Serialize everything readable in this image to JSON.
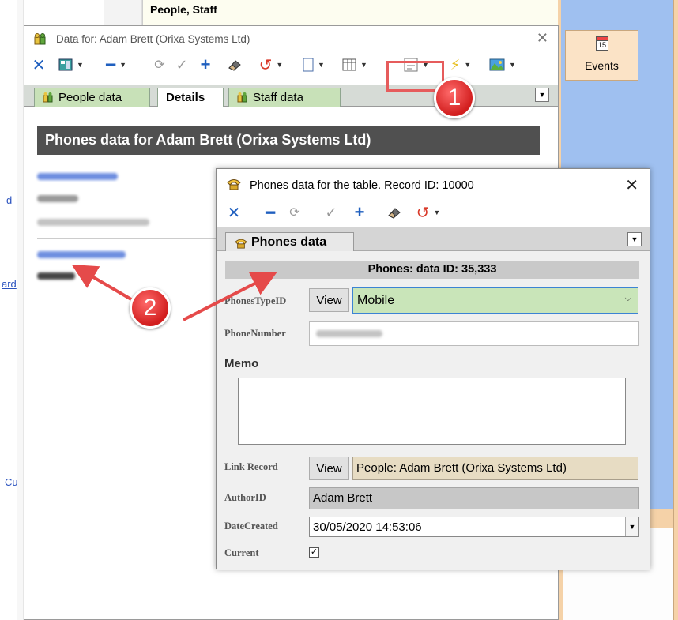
{
  "background": {
    "top_label": "People, Staff",
    "left_edge_fragments": [
      "d",
      "ard",
      "Cu"
    ],
    "events_label": "Events",
    "events_icon_day": "15",
    "icon": "calendar-icon"
  },
  "main_window": {
    "title": "Data for: Adam Brett (Orixa Systems Ltd)",
    "close_glyph": "✕",
    "toolbar_icons": [
      "delete-x-icon",
      "layout-icon",
      "minus-icon",
      "refresh-icon",
      "check-icon",
      "plus-icon",
      "eraser-icon",
      "undo-icon",
      "document-icon",
      "grid-icon",
      "form-icon",
      "lightning-icon",
      "image-icon"
    ],
    "tabs": [
      {
        "label": "People data",
        "active": false
      },
      {
        "label": "Details",
        "active": true
      },
      {
        "label": "Staff data",
        "active": false
      }
    ],
    "section_header": "Phones data for Adam Brett (Orixa Systems Ltd)"
  },
  "phones_window": {
    "title": "Phones data for the  table. Record ID: 10000",
    "close_glyph": "✕",
    "tab_label": "Phones data",
    "header": "Phones: data ID: 35,333",
    "fields": {
      "phones_type_label": "PhonesTypeID",
      "phones_type_value": "Mobile",
      "phone_number_label": "PhoneNumber",
      "memo_label": "Memo",
      "link_record_label": "Link Record",
      "link_record_value": "People: Adam Brett (Orixa Systems Ltd)",
      "author_label": "AuthorID",
      "author_value": "Adam Brett",
      "date_created_label": "DateCreated",
      "date_created_value": "30/05/2020 14:53:06",
      "current_label": "Current",
      "current_checked": true
    },
    "view_label": "View"
  },
  "annotations": {
    "badge1": "1",
    "badge2": "2",
    "colors": {
      "badge": "#d21e1e",
      "highlight": "#e65c5c"
    }
  }
}
